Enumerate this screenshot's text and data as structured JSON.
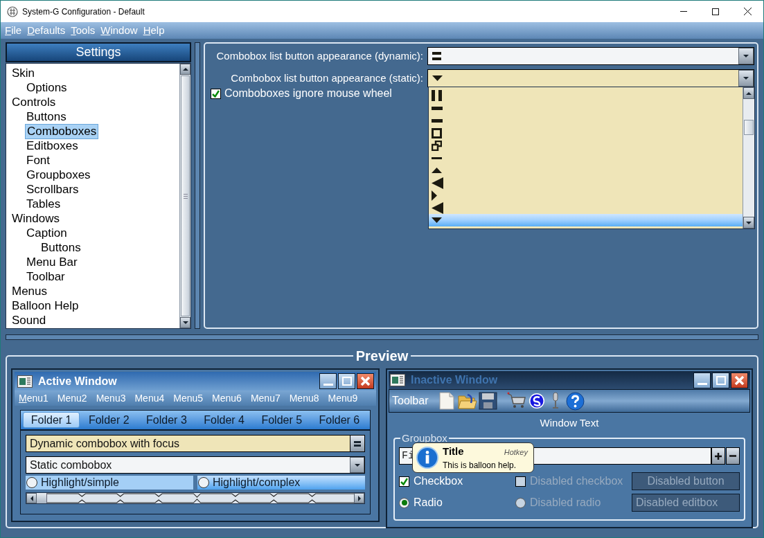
{
  "window": {
    "title": "System-G Configuration - Default"
  },
  "menu_bar": [
    "File",
    "Defaults",
    "Tools",
    "Window",
    "Help"
  ],
  "settings": {
    "title": "Settings",
    "tree": [
      {
        "label": "Skin",
        "selected": false,
        "children": [
          {
            "label": "Options",
            "selected": false
          }
        ]
      },
      {
        "label": "Controls",
        "selected": false,
        "children": [
          {
            "label": "Buttons",
            "selected": false
          },
          {
            "label": "Comboboxes",
            "selected": true
          },
          {
            "label": "Editboxes",
            "selected": false
          },
          {
            "label": "Font",
            "selected": false
          },
          {
            "label": "Groupboxes",
            "selected": false
          },
          {
            "label": "Scrollbars",
            "selected": false
          },
          {
            "label": "Tables",
            "selected": false
          }
        ]
      },
      {
        "label": "Windows",
        "selected": false,
        "children": [
          {
            "label": "Caption",
            "selected": false,
            "children": [
              {
                "label": "Buttons",
                "selected": false
              }
            ]
          },
          {
            "label": "Menu Bar",
            "selected": false
          },
          {
            "label": "Toolbar",
            "selected": false
          }
        ]
      },
      {
        "label": "Menus",
        "selected": false
      },
      {
        "label": "Balloon Help",
        "selected": false
      },
      {
        "label": "Sound",
        "selected": false
      }
    ]
  },
  "combobox_settings": {
    "dynamic": {
      "label": "Combobox list button appearance (dynamic):",
      "focused": false
    },
    "static": {
      "label": "Combobox list button appearance (static):",
      "focused": true
    },
    "ignore_wheel": {
      "label": "Comboboxes ignore mouse wheel",
      "checked": true
    },
    "list": [
      {
        "kind": "pause",
        "selected": false
      },
      {
        "kind": "bar",
        "selected": false
      },
      {
        "kind": "bar",
        "selected": false
      },
      {
        "kind": "square",
        "selected": false
      },
      {
        "kind": "restore",
        "selected": false
      },
      {
        "kind": "minus",
        "selected": false
      },
      {
        "kind": "triangle-up",
        "selected": false
      },
      {
        "kind": "triangle-left-large",
        "selected": false
      },
      {
        "kind": "triangle-right",
        "selected": false
      },
      {
        "kind": "triangle-left-large",
        "selected": false
      },
      {
        "kind": "triangle-down",
        "selected": true
      }
    ]
  },
  "preview": {
    "title": "Preview",
    "active_window": {
      "title": "Active Window",
      "menus": [
        {
          "label": "Menu1",
          "mnemonic": true
        },
        {
          "label": "Menu2",
          "mnemonic": false
        },
        {
          "label": "Menu3",
          "mnemonic": false
        },
        {
          "label": "Menu4",
          "mnemonic": false
        },
        {
          "label": "Menu5",
          "mnemonic": false
        },
        {
          "label": "Menu6",
          "mnemonic": false
        },
        {
          "label": "Menu7",
          "mnemonic": false
        },
        {
          "label": "Menu8",
          "mnemonic": false
        },
        {
          "label": "Menu9",
          "mnemonic": false
        }
      ],
      "tabs": [
        {
          "label": "Folder 1",
          "selected": true
        },
        {
          "label": "Folder 2",
          "selected": false
        },
        {
          "label": "Folder 3",
          "selected": false
        },
        {
          "label": "Folder 4",
          "selected": false
        },
        {
          "label": "Folder 5",
          "selected": false
        },
        {
          "label": "Folder 6",
          "selected": false
        }
      ],
      "dynamic_combobox": {
        "value": "Dynamic combobox with focus",
        "focused": true
      },
      "static_combobox": {
        "value": "Static combobox",
        "focused": false
      },
      "radios": [
        {
          "label": "Highlight/simple",
          "selected": false,
          "kind": "simple"
        },
        {
          "label": "Highlight/complex",
          "selected": false,
          "kind": "complex"
        }
      ]
    },
    "inactive_window": {
      "title": "Inactive Window",
      "toolbar_label": "Toolbar",
      "window_text": "Window Text",
      "groupbox": {
        "title": "Groupbox",
        "field_value": "Fi",
        "checkbox": {
          "label": "Checkbox",
          "checked": true,
          "disabled": false
        },
        "disabled_checkbox": {
          "label": "Disabled checkbox",
          "checked": false,
          "disabled": true
        },
        "disabled_button": "Disabled button",
        "radio": {
          "label": "Radio",
          "selected": true,
          "disabled": false
        },
        "disabled_radio": {
          "label": "Disabled radio",
          "selected": false,
          "disabled": true
        },
        "disabled_editbox": "Disabled editbox"
      }
    },
    "balloon": {
      "title": "Title",
      "hotkey": "Hotkey",
      "text": "This is balloon help."
    }
  }
}
